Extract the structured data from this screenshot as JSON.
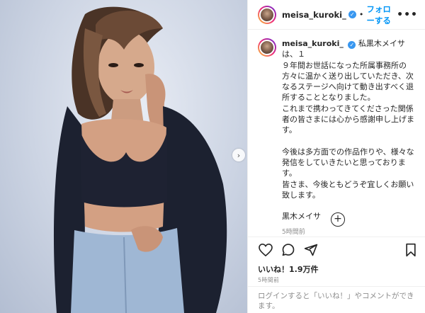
{
  "post": {
    "username": "meisa_kuroki_",
    "verified_icon": "verified-badge-icon",
    "follow_label": "フォローする",
    "separator": "•",
    "more_label": "•••"
  },
  "caption": {
    "username": "meisa_kuroki_",
    "lines": [
      "私黒木メイサは、１",
      "９年間お世話になった所属事務所の",
      "方々に温かく送り出していただき、次",
      "なるステージへ向けて動き出すべく退",
      "所することとなりました。",
      "これまで携わってきてくださった関係",
      "者の皆さまには心から感謝申し上げま",
      "す。",
      "",
      "今後は多方面での作品作りや、様々な",
      "発信をしていきたいと思っております。",
      "皆さま、今後ともどうぞ宜しくお願い",
      "致します。",
      "",
      "黒木メイサ"
    ],
    "time": "5時間前"
  },
  "actions": {
    "like_icon": "heart-icon",
    "comment_icon": "comment-icon",
    "share_icon": "share-icon",
    "save_icon": "bookmark-icon",
    "load_more_icon": "plus-circle-icon"
  },
  "likes_text": "いいね！1.9万件",
  "posted_text": "5時間前",
  "login_text": "ログインすると「いいね！」やコメントができます。",
  "colors": {
    "accent": "#0095f6",
    "text": "#262626",
    "muted": "#8e8e8e",
    "background": "#ffffff"
  }
}
